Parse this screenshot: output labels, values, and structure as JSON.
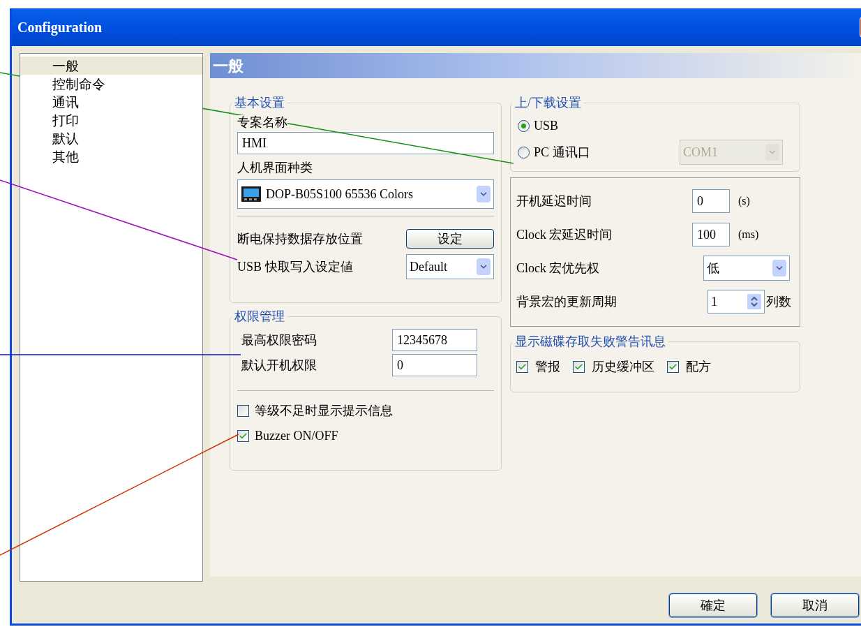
{
  "window": {
    "title": "Configuration"
  },
  "sidebar": {
    "items": [
      {
        "label": "一般",
        "selected": true
      },
      {
        "label": "控制命令",
        "selected": false
      },
      {
        "label": "通讯",
        "selected": false
      },
      {
        "label": "打印",
        "selected": false
      },
      {
        "label": "默认",
        "selected": false
      },
      {
        "label": "其他",
        "selected": false
      }
    ]
  },
  "panel": {
    "title": "一般"
  },
  "basic": {
    "title": "基本设置",
    "project_label": "专案名称",
    "project_value": "HMI",
    "hmi_label": "人机界面种类",
    "hmi_value": "DOP-B05S100 65536 Colors",
    "retain_label": "断电保持数据存放位置",
    "retain_button": "设定",
    "usb_label": "USB 快取写入设定値",
    "usb_value": "Default"
  },
  "permissions": {
    "title": "权限管理",
    "fields": [
      {
        "label": "最高权限密码",
        "value": "12345678"
      },
      {
        "label": "默认开机权限",
        "value": "0"
      }
    ],
    "checkboxes": [
      {
        "label": "等级不足时显示提示信息",
        "checked": false
      },
      {
        "label": "Buzzer ON/OFF",
        "checked": true
      }
    ]
  },
  "transfer": {
    "title": "上/下载设置",
    "options": [
      {
        "label": "USB",
        "selected": true
      },
      {
        "label": "PC 通讯口",
        "selected": false
      }
    ],
    "port_value": "COM1",
    "port_disabled": true
  },
  "timing": [
    {
      "kind": "input",
      "label": "开机延迟时间",
      "value": "0",
      "unit": "(s)"
    },
    {
      "kind": "input",
      "label": "Clock 宏延迟时间",
      "value": "100",
      "unit": "(ms)"
    },
    {
      "kind": "select",
      "label": "Clock 宏优先权",
      "value": "低"
    },
    {
      "kind": "spinner",
      "label": "背景宏的更新周期",
      "value": "1",
      "unit": "列数"
    }
  ],
  "disk_warning": {
    "title": "显示磁碟存取失败警告讯息",
    "checkboxes": [
      {
        "label": "警报",
        "checked": true
      },
      {
        "label": "历史缓冲区",
        "checked": true
      },
      {
        "label": "配方",
        "checked": true
      }
    ]
  },
  "buttons": [
    {
      "label": "確定"
    },
    {
      "label": "取消"
    }
  ]
}
